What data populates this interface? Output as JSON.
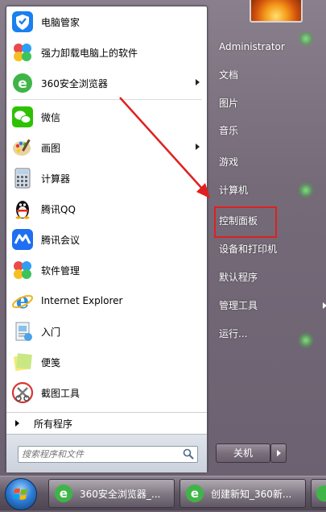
{
  "start_menu": {
    "programs": [
      {
        "label": "电脑管家",
        "icon": "tencent-pc-manager-icon",
        "submenu": false
      },
      {
        "label": "强力卸载电脑上的软件",
        "icon": "uninstall-clover-icon",
        "submenu": false
      },
      {
        "label": "360安全浏览器",
        "icon": "360-browser-icon",
        "submenu": true
      },
      {
        "label": "微信",
        "icon": "wechat-icon",
        "submenu": false
      },
      {
        "label": "画图",
        "icon": "paint-icon",
        "submenu": true
      },
      {
        "label": "计算器",
        "icon": "calculator-icon",
        "submenu": false
      },
      {
        "label": "腾讯QQ",
        "icon": "qq-penguin-icon",
        "submenu": false
      },
      {
        "label": "腾讯会议",
        "icon": "tencent-meeting-icon",
        "submenu": false
      },
      {
        "label": "软件管理",
        "icon": "software-manager-icon",
        "submenu": false
      },
      {
        "label": "Internet Explorer",
        "icon": "internet-explorer-icon",
        "submenu": false
      },
      {
        "label": "入门",
        "icon": "getting-started-icon",
        "submenu": false
      },
      {
        "label": "便笺",
        "icon": "sticky-notes-icon",
        "submenu": false
      },
      {
        "label": "截图工具",
        "icon": "snipping-tool-icon",
        "submenu": false
      }
    ],
    "all_programs": "所有程序",
    "search_placeholder": "搜索程序和文件",
    "right_items": [
      {
        "label": "Administrator",
        "submenu": false
      },
      {
        "label": "文档",
        "submenu": false
      },
      {
        "label": "图片",
        "submenu": false
      },
      {
        "label": "音乐",
        "submenu": false
      },
      {
        "label": "游戏",
        "submenu": false
      },
      {
        "label": "计算机",
        "submenu": false
      },
      {
        "label": "控制面板",
        "submenu": false,
        "highlighted": true
      },
      {
        "label": "设备和打印机",
        "submenu": false
      },
      {
        "label": "默认程序",
        "submenu": false
      },
      {
        "label": "管理工具",
        "submenu": true
      },
      {
        "label": "运行...",
        "submenu": false
      }
    ],
    "shutdown_label": "关机"
  },
  "taskbar": {
    "buttons": [
      {
        "label": "360安全浏览器_...",
        "icon": "360-browser-icon"
      },
      {
        "label": "创建新知_360新...",
        "icon": "360-browser-icon"
      }
    ]
  },
  "colors": {
    "highlight_box": "#e02020",
    "annotation_arrow": "#e02020"
  }
}
